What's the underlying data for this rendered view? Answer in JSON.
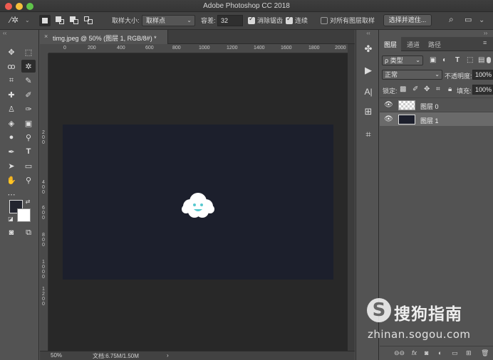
{
  "window": {
    "title": "Adobe Photoshop CC 2018"
  },
  "options_bar": {
    "tool_icon": "magic-wand-icon",
    "sample_size_label": "取样大小:",
    "sample_size_value": "取样点",
    "tolerance_label": "容差:",
    "tolerance_value": "32",
    "antialias_label": "消除锯齿",
    "antialias_checked": true,
    "contiguous_label": "连续",
    "contiguous_checked": true,
    "all_layers_label": "对所有图层取样",
    "all_layers_checked": false,
    "select_mask_button": "选择并遮住..."
  },
  "document": {
    "tab_title": "timg.jpeg @ 50% (图层 1, RGB/8#) *",
    "tab_close": "×",
    "ruler_h_labels": [
      "0",
      "200",
      "400",
      "600",
      "800",
      "1000",
      "1200",
      "1400",
      "1600",
      "1800",
      "2000"
    ],
    "ruler_v_labels": [
      "2",
      "0",
      "0",
      "4",
      "0",
      "0",
      "6",
      "0",
      "0",
      "8",
      "0",
      "0",
      "1",
      "0",
      "0",
      "0",
      "1",
      "2",
      "0",
      "0"
    ],
    "image_color": "#1c1f2c",
    "canvas_color": "#282828"
  },
  "status_bar": {
    "zoom": "50%",
    "doc_info": "文档:6.75M/1.50M",
    "arrow": "›"
  },
  "layers_panel": {
    "tabs": [
      "图层",
      "通道",
      "路径"
    ],
    "active_tab": "图层",
    "filter_kind": "ρ 类型",
    "blend_mode": "正常",
    "opacity_label": "不透明度:",
    "opacity_value": "100%",
    "lock_label": "锁定:",
    "fill_label": "填充:",
    "fill_value": "100%",
    "layers": [
      {
        "name": "图层 0",
        "selected": false,
        "thumb": "checker"
      },
      {
        "name": "图层 1",
        "selected": true,
        "thumb": "dark"
      }
    ]
  },
  "watermark": {
    "brand_cn": "搜狗指南",
    "url": "zhinan.sogou.com"
  }
}
